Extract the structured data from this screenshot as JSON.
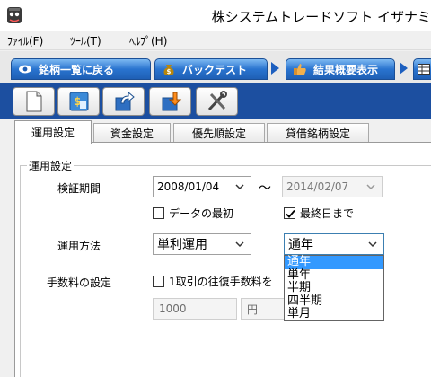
{
  "window": {
    "title": "株システムトレードソフト イザナミ"
  },
  "menu": [
    {
      "label": "ﾌｧｲﾙ(F)"
    },
    {
      "label": "ﾂｰﾙ(T)"
    },
    {
      "label": "ﾍﾙﾌﾟ(H)"
    }
  ],
  "nav": {
    "stock_list": "銘柄一覧に戻る",
    "backtest": "バックテスト",
    "summary": "結果概要表示"
  },
  "toolbar": [
    "new-document-icon",
    "calculator-icon",
    "export-icon",
    "import-icon",
    "tools-icon"
  ],
  "tabs": [
    "運用設定",
    "資金設定",
    "優先順設定",
    "貸借銘柄設定"
  ],
  "active_tab": "運用設定",
  "group_title": "運用設定",
  "period": {
    "label": "検証期間",
    "start": "2008/01/04",
    "separator": "～",
    "end": "2014/02/07",
    "from_start_label": "データの最初",
    "from_start_checked": false,
    "to_last_label": "最終日まで",
    "to_last_checked": true
  },
  "method": {
    "label": "運用方法",
    "interest": "単利運用",
    "unit": "通年",
    "options": [
      "通年",
      "単年",
      "半期",
      "四半期",
      "単月"
    ],
    "highlighted": "通年"
  },
  "commission": {
    "label": "手数料の設定",
    "check_label": "1取引の往復手数料を",
    "checked": false,
    "amount": "1000",
    "unit": "円"
  },
  "colors": {
    "accent": "#1c4fa0",
    "nav_blue": "#2a74cf",
    "selection": "#3399ff"
  }
}
